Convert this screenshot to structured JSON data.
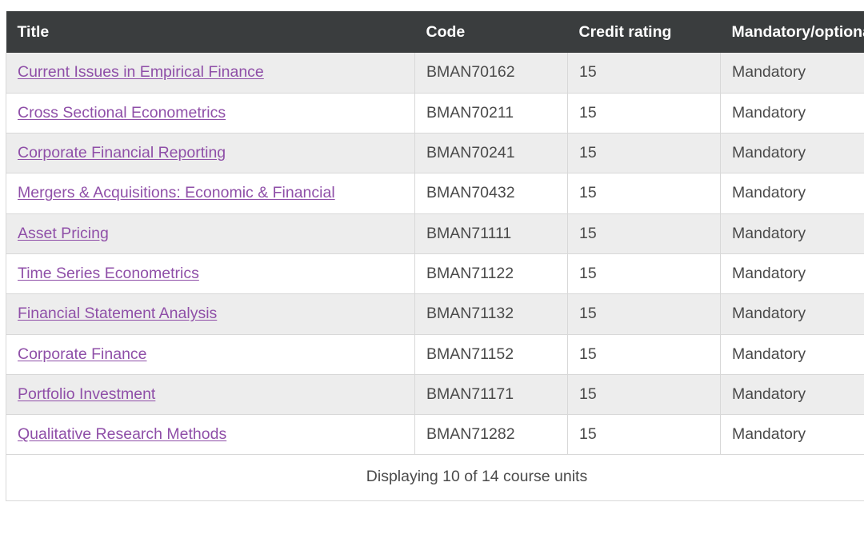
{
  "table": {
    "columns": [
      {
        "key": "title",
        "label": "Title"
      },
      {
        "key": "code",
        "label": "Code"
      },
      {
        "key": "credit",
        "label": "Credit rating"
      },
      {
        "key": "mandatory",
        "label": "Mandatory/optional"
      }
    ],
    "header": {
      "title": "Title",
      "code": "Code",
      "credit": "Credit rating",
      "mandatory": "Mandatory/optional"
    },
    "rows": [
      {
        "title": "Current Issues in Empirical Finance",
        "code": "BMAN70162",
        "credit": "15",
        "mandatory": "Mandatory"
      },
      {
        "title": "Cross Sectional Econometrics",
        "code": "BMAN70211",
        "credit": "15",
        "mandatory": "Mandatory"
      },
      {
        "title": "Corporate Financial Reporting",
        "code": "BMAN70241",
        "credit": "15",
        "mandatory": "Mandatory"
      },
      {
        "title": "Mergers & Acquisitions: Economic & Financial",
        "code": "BMAN70432",
        "credit": "15",
        "mandatory": "Mandatory"
      },
      {
        "title": "Asset Pricing",
        "code": "BMAN71111",
        "credit": "15",
        "mandatory": "Mandatory"
      },
      {
        "title": "Time Series Econometrics",
        "code": "BMAN71122",
        "credit": "15",
        "mandatory": "Mandatory"
      },
      {
        "title": "Financial Statement Analysis",
        "code": "BMAN71132",
        "credit": "15",
        "mandatory": "Mandatory"
      },
      {
        "title": "Corporate Finance",
        "code": "BMAN71152",
        "credit": "15",
        "mandatory": "Mandatory"
      },
      {
        "title": "Portfolio Investment",
        "code": "BMAN71171",
        "credit": "15",
        "mandatory": "Mandatory"
      },
      {
        "title": "Qualitative Research Methods",
        "code": "BMAN71282",
        "credit": "15",
        "mandatory": "Mandatory"
      }
    ],
    "footer": {
      "summary": "Displaying 10 of 14 course units"
    }
  },
  "colors": {
    "header_background": "#3a3d3e",
    "header_text": "#ffffff",
    "row_stripe": "#ededed",
    "row_plain": "#ffffff",
    "border": "#d8d8d8",
    "link": "#8f4fa8",
    "body_text": "#4a4a4a"
  }
}
